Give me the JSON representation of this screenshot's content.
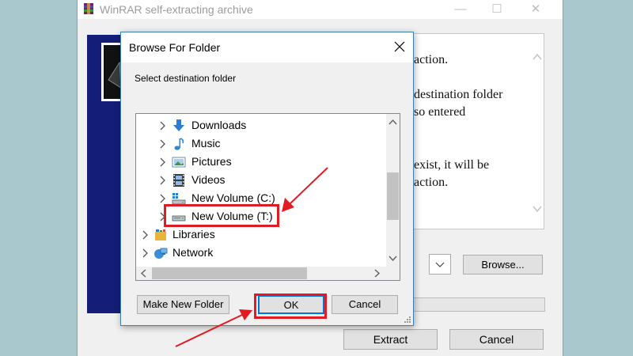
{
  "window": {
    "title": "WinRAR self-extracting archive",
    "minimize_glyph": "—",
    "maximize_glyph": "☐",
    "close_glyph": "✕",
    "text_lines": [
      "action.",
      "destination folder",
      "so entered",
      "exist, it will be",
      "action."
    ],
    "browse_label": "Browse...",
    "extract_label": "Extract",
    "cancel_label": "Cancel"
  },
  "dialog": {
    "title": "Browse For Folder",
    "prompt": "Select destination folder",
    "tree": [
      {
        "label": "Downloads",
        "icon": "download-arrow-icon",
        "selected": false
      },
      {
        "label": "Music",
        "icon": "music-note-icon",
        "selected": false
      },
      {
        "label": "Pictures",
        "icon": "pictures-icon",
        "selected": false
      },
      {
        "label": "Videos",
        "icon": "film-strip-icon",
        "selected": false
      },
      {
        "label": "New Volume (C:)",
        "icon": "drive-icon",
        "selected": false
      },
      {
        "label": "New Volume (T:)",
        "icon": "drive-icon",
        "selected": true
      },
      {
        "label": "Libraries",
        "icon": "libraries-icon",
        "selected": false
      },
      {
        "label": "Network",
        "icon": "network-icon",
        "selected": false
      }
    ],
    "make_new_folder_label": "Make New Folder",
    "ok_label": "OK",
    "cancel_label": "Cancel"
  },
  "colors": {
    "annotation": "#e11b22",
    "dialog_border": "#3c7fb1",
    "sidebar": "#141e78"
  }
}
